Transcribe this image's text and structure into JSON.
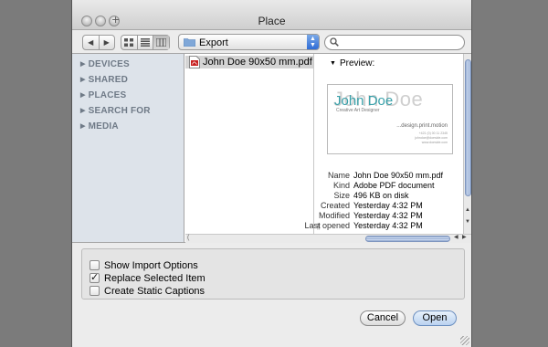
{
  "window": {
    "title": "Place"
  },
  "toolbar": {
    "back_icon": "back-arrow-icon",
    "forward_icon": "forward-arrow-icon",
    "view_modes": [
      "icon-view-icon",
      "list-view-icon",
      "column-view-icon"
    ],
    "active_view": "column-view-icon",
    "location": "Export",
    "search_placeholder": ""
  },
  "sidebar": {
    "items": [
      {
        "label": "DEVICES"
      },
      {
        "label": "SHARED"
      },
      {
        "label": "PLACES"
      },
      {
        "label": "SEARCH FOR"
      },
      {
        "label": "MEDIA"
      }
    ]
  },
  "files": [
    {
      "name": "John Doe 90x50 mm.pdf",
      "selected": true,
      "icon": "pdf-file-icon"
    }
  ],
  "preview": {
    "label": "Preview:",
    "card": {
      "ghost_name": "John Doe",
      "name": "John Doe",
      "role": "Creative Art Designer",
      "tagline": "...design.print.motion",
      "contact_lines": [
        "+421 (0) 00 11 2345",
        "johndoe@doeside.com",
        "www.doeside.com"
      ]
    },
    "info": [
      {
        "key": "Name",
        "value": "John Doe 90x50 mm.pdf"
      },
      {
        "key": "Kind",
        "value": "Adobe PDF document"
      },
      {
        "key": "Size",
        "value": "496 KB on disk"
      },
      {
        "key": "Created",
        "value": "Yesterday 4:32 PM"
      },
      {
        "key": "Modified",
        "value": "Yesterday 4:32 PM"
      },
      {
        "key": "Last opened",
        "value": "Yesterday 4:32 PM"
      }
    ]
  },
  "options": [
    {
      "label": "Show Import Options",
      "checked": false
    },
    {
      "label": "Replace Selected Item",
      "checked": true
    },
    {
      "label": "Create Static Captions",
      "checked": false
    }
  ],
  "buttons": {
    "cancel": "Cancel",
    "open": "Open"
  },
  "colors": {
    "accent": "#39a1aa",
    "selection": "#d4d4d4",
    "sidebar": "#dde3ea",
    "default_button": "#bad2f0"
  }
}
